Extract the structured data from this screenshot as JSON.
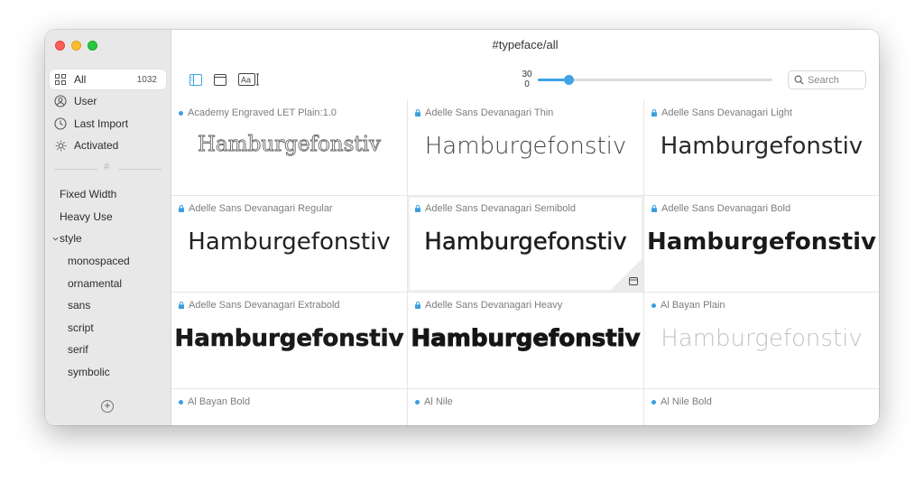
{
  "window": {
    "title": "#typeface/all"
  },
  "colors": {
    "accent": "#3fa3e6",
    "dot": "#3a9ee0"
  },
  "sidebar": {
    "items": [
      {
        "label": "All",
        "count": "1032",
        "icon": "grid-icon"
      },
      {
        "label": "User",
        "icon": "user-icon"
      },
      {
        "label": "Last Import",
        "icon": "clock-icon"
      },
      {
        "label": "Activated",
        "icon": "sun-icon"
      }
    ],
    "separator_symbol": "#",
    "tags": [
      "Fixed Width",
      "Heavy Use"
    ],
    "group": {
      "label": "style",
      "children": [
        "monospaced",
        "ornamental",
        "sans",
        "script",
        "serif",
        "symbolic"
      ]
    },
    "add_label": "+"
  },
  "toolbar": {
    "slider": {
      "max_label": "30",
      "min_label": "0",
      "value_fraction": 0.13
    },
    "search_placeholder": "Search"
  },
  "fonts": [
    {
      "name": "Academy Engraved LET Plain:1.0",
      "sample": "Hamburgefonstiv",
      "marker": "dot"
    },
    {
      "name": "Adelle Sans Devanagari Thin",
      "sample": "Hamburgefonstiv",
      "marker": "lock"
    },
    {
      "name": "Adelle Sans Devanagari Light",
      "sample": "Hamburgefonstiv",
      "marker": "lock"
    },
    {
      "name": "Adelle Sans Devanagari Regular",
      "sample": "Hamburgefonstiv",
      "marker": "lock"
    },
    {
      "name": "Adelle Sans Devanagari Semibold",
      "sample": "Hamburgefonstiv",
      "marker": "lock"
    },
    {
      "name": "Adelle Sans Devanagari Bold",
      "sample": "Hamburgefonstiv",
      "marker": "lock"
    },
    {
      "name": "Adelle Sans Devanagari Extrabold",
      "sample": "Hamburgefonstiv",
      "marker": "lock"
    },
    {
      "name": "Adelle Sans Devanagari Heavy",
      "sample": "Hamburgefonstiv",
      "marker": "lock"
    },
    {
      "name": "Al Bayan Plain",
      "sample": "Hamburgefonstiv",
      "marker": "dot"
    },
    {
      "name": "Al Bayan Bold",
      "sample": "",
      "marker": "dot"
    },
    {
      "name": "Al Nile",
      "sample": "",
      "marker": "dot"
    },
    {
      "name": "Al Nile Bold",
      "sample": "",
      "marker": "dot"
    }
  ]
}
